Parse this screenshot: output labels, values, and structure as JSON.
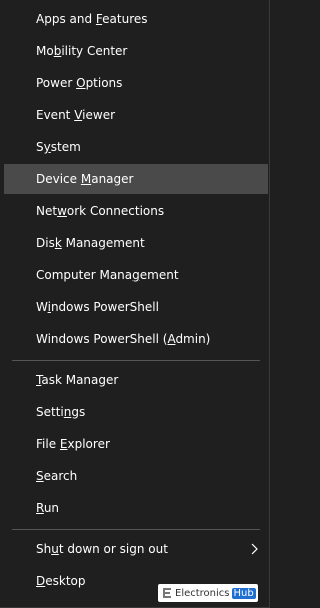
{
  "menu": {
    "items": [
      {
        "pre": "Apps and ",
        "acc": "F",
        "post": "eatures"
      },
      {
        "pre": "Mo",
        "acc": "b",
        "post": "ility Center"
      },
      {
        "pre": "Power ",
        "acc": "O",
        "post": "ptions"
      },
      {
        "pre": "Event ",
        "acc": "V",
        "post": "iewer"
      },
      {
        "pre": "S",
        "acc": "y",
        "post": "stem"
      },
      {
        "pre": "Device ",
        "acc": "M",
        "post": "anager"
      },
      {
        "pre": "Net",
        "acc": "w",
        "post": "ork Connections"
      },
      {
        "pre": "Dis",
        "acc": "k",
        "post": " Management"
      },
      {
        "pre": "Computer Mana",
        "acc": "g",
        "post": "ement"
      },
      {
        "pre": "W",
        "acc": "i",
        "post": "ndows PowerShell"
      },
      {
        "pre": "Windows PowerShell (",
        "acc": "A",
        "post": "dmin)"
      },
      {
        "pre": "",
        "acc": "T",
        "post": "ask Manager"
      },
      {
        "pre": "Setti",
        "acc": "n",
        "post": "gs"
      },
      {
        "pre": "File ",
        "acc": "E",
        "post": "xplorer"
      },
      {
        "pre": "",
        "acc": "S",
        "post": "earch"
      },
      {
        "pre": "",
        "acc": "R",
        "post": "un"
      },
      {
        "pre": "Sh",
        "acc": "u",
        "post": "t down or sign out"
      },
      {
        "pre": "",
        "acc": "D",
        "post": "esktop"
      }
    ],
    "highlighted_label": "Device Manager"
  },
  "watermark": {
    "text": "Electronics",
    "badge": "Hub"
  },
  "colors": {
    "background": "#1f1f1f",
    "highlight": "#4a4a4a",
    "text": "#ffffff",
    "separator": "#555555"
  }
}
